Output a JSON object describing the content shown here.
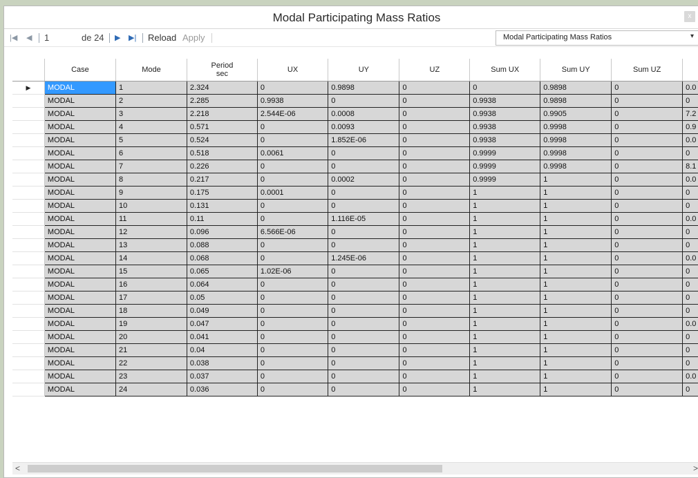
{
  "window": {
    "title": "Modal Participating Mass Ratios",
    "close_glyph": "x"
  },
  "toolbar": {
    "first_icon": "|◀",
    "prev_icon": "◀",
    "page_value": "1",
    "page_of": "de 24",
    "next_icon": "▶",
    "last_icon": "▶|",
    "reload_label": "Reload",
    "apply_label": "Apply",
    "table_select_value": "Modal Participating Mass Ratios"
  },
  "table": {
    "columns": [
      "Case",
      "Mode",
      "Period",
      "UX",
      "UY",
      "UZ",
      "Sum UX",
      "Sum UY",
      "Sum UZ",
      ""
    ],
    "period_unit": "sec",
    "rows": [
      [
        "MODAL",
        "1",
        "2.324",
        "0",
        "0.9898",
        "0",
        "0",
        "0.9898",
        "0",
        "0.0"
      ],
      [
        "MODAL",
        "2",
        "2.285",
        "0.9938",
        "0",
        "0",
        "0.9938",
        "0.9898",
        "0",
        "0"
      ],
      [
        "MODAL",
        "3",
        "2.218",
        "2.544E-06",
        "0.0008",
        "0",
        "0.9938",
        "0.9905",
        "0",
        "7.2"
      ],
      [
        "MODAL",
        "4",
        "0.571",
        "0",
        "0.0093",
        "0",
        "0.9938",
        "0.9998",
        "0",
        "0.9"
      ],
      [
        "MODAL",
        "5",
        "0.524",
        "0",
        "1.852E-06",
        "0",
        "0.9938",
        "0.9998",
        "0",
        "0.0"
      ],
      [
        "MODAL",
        "6",
        "0.518",
        "0.0061",
        "0",
        "0",
        "0.9999",
        "0.9998",
        "0",
        "0"
      ],
      [
        "MODAL",
        "7",
        "0.226",
        "0",
        "0",
        "0",
        "0.9999",
        "0.9998",
        "0",
        "8.1"
      ],
      [
        "MODAL",
        "8",
        "0.217",
        "0",
        "0.0002",
        "0",
        "0.9999",
        "1",
        "0",
        "0.0"
      ],
      [
        "MODAL",
        "9",
        "0.175",
        "0.0001",
        "0",
        "0",
        "1",
        "1",
        "0",
        "0"
      ],
      [
        "MODAL",
        "10",
        "0.131",
        "0",
        "0",
        "0",
        "1",
        "1",
        "0",
        "0"
      ],
      [
        "MODAL",
        "11",
        "0.11",
        "0",
        "1.116E-05",
        "0",
        "1",
        "1",
        "0",
        "0.0"
      ],
      [
        "MODAL",
        "12",
        "0.096",
        "6.566E-06",
        "0",
        "0",
        "1",
        "1",
        "0",
        "0"
      ],
      [
        "MODAL",
        "13",
        "0.088",
        "0",
        "0",
        "0",
        "1",
        "1",
        "0",
        "0"
      ],
      [
        "MODAL",
        "14",
        "0.068",
        "0",
        "1.245E-06",
        "0",
        "1",
        "1",
        "0",
        "0.0"
      ],
      [
        "MODAL",
        "15",
        "0.065",
        "1.02E-06",
        "0",
        "0",
        "1",
        "1",
        "0",
        "0"
      ],
      [
        "MODAL",
        "16",
        "0.064",
        "0",
        "0",
        "0",
        "1",
        "1",
        "0",
        "0"
      ],
      [
        "MODAL",
        "17",
        "0.05",
        "0",
        "0",
        "0",
        "1",
        "1",
        "0",
        "0"
      ],
      [
        "MODAL",
        "18",
        "0.049",
        "0",
        "0",
        "0",
        "1",
        "1",
        "0",
        "0"
      ],
      [
        "MODAL",
        "19",
        "0.047",
        "0",
        "0",
        "0",
        "1",
        "1",
        "0",
        "0.0"
      ],
      [
        "MODAL",
        "20",
        "0.041",
        "0",
        "0",
        "0",
        "1",
        "1",
        "0",
        "0"
      ],
      [
        "MODAL",
        "21",
        "0.04",
        "0",
        "0",
        "0",
        "1",
        "1",
        "0",
        "0"
      ],
      [
        "MODAL",
        "22",
        "0.038",
        "0",
        "0",
        "0",
        "1",
        "1",
        "0",
        "0"
      ],
      [
        "MODAL",
        "23",
        "0.037",
        "0",
        "0",
        "0",
        "1",
        "1",
        "0",
        "0.0"
      ],
      [
        "MODAL",
        "24",
        "0.036",
        "0",
        "0",
        "0",
        "1",
        "1",
        "0",
        "0"
      ]
    ],
    "current_row_marker": "▶"
  },
  "scrollbar": {
    "left_arrow": "<",
    "right_arrow": ">"
  },
  "colors": {
    "selected_cell": "#3399ff",
    "cell_bg": "#d7d7d7",
    "accent_nav": "#2f6bb5"
  }
}
